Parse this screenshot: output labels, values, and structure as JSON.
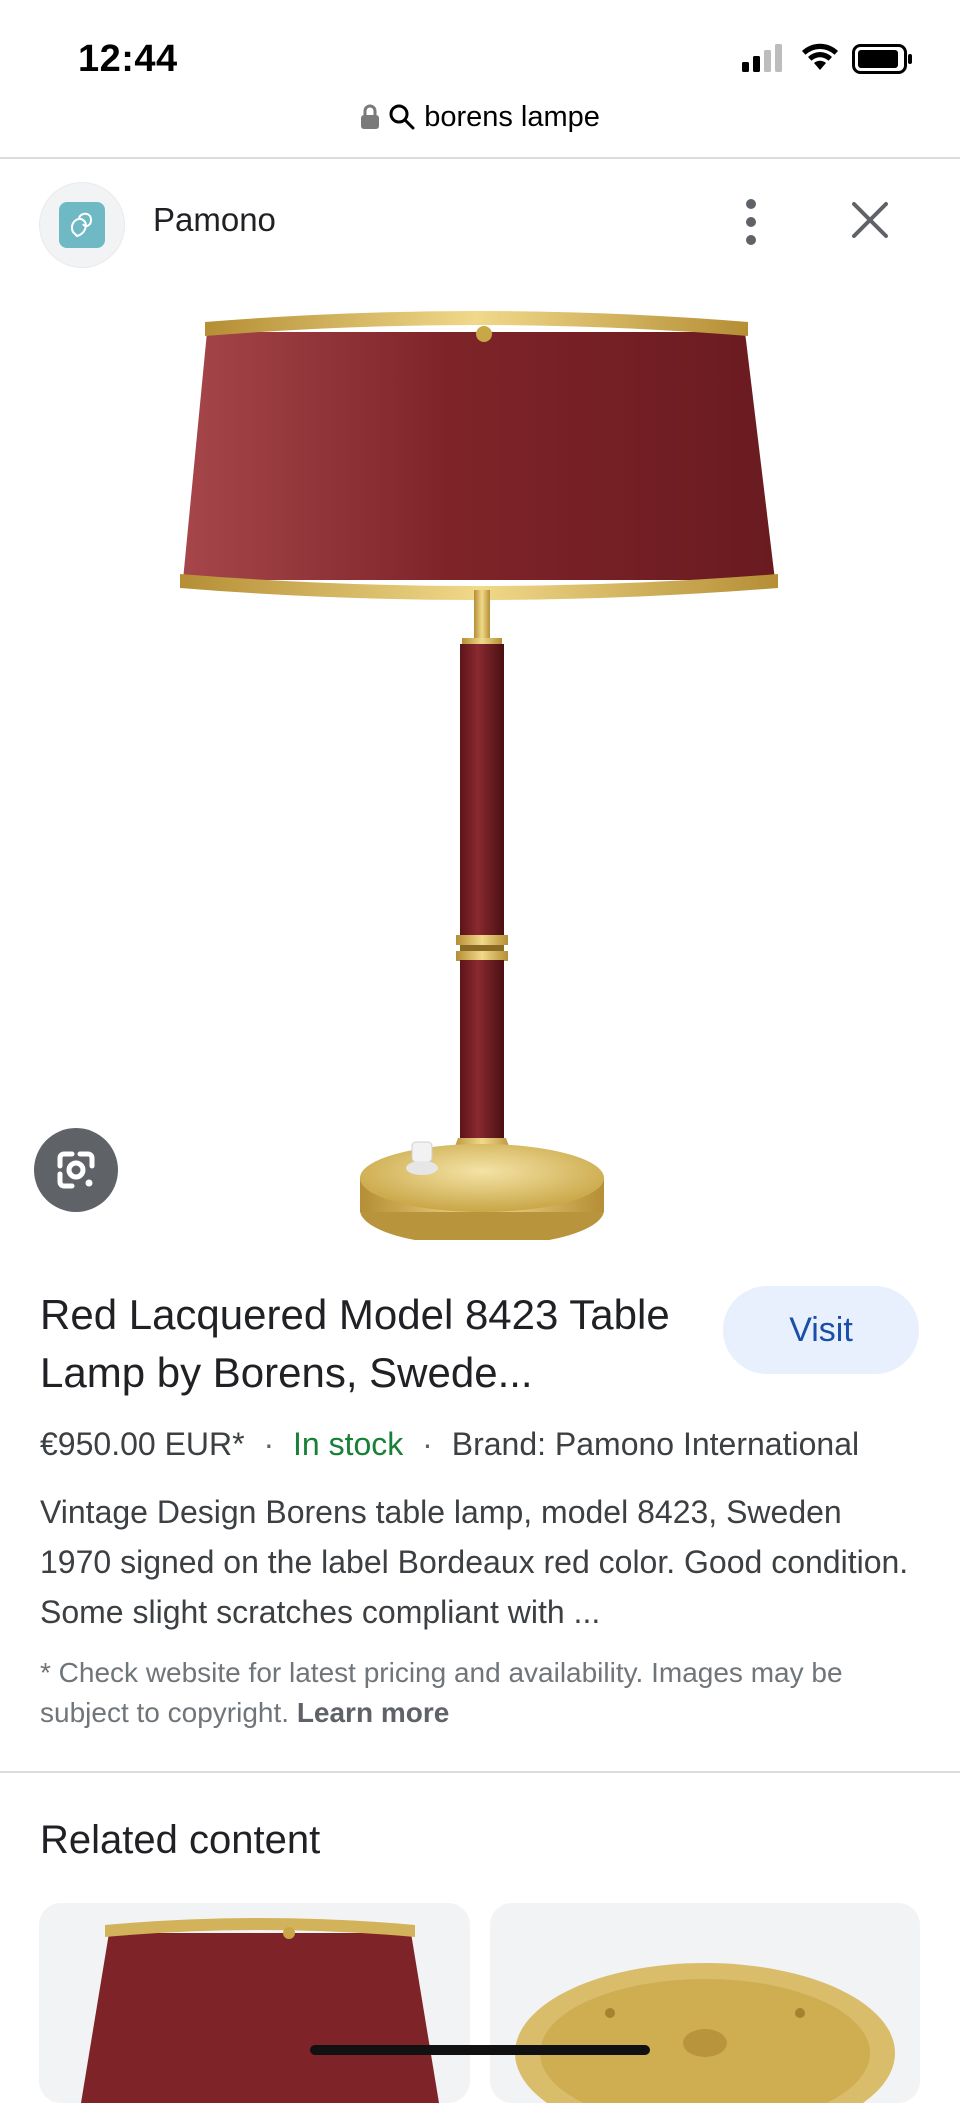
{
  "status_bar": {
    "time": "12:44"
  },
  "address_bar": {
    "query": "borens lampe"
  },
  "source": {
    "name": "Pamono",
    "avatar_color": "#6fb9c4"
  },
  "product": {
    "title": "Red Lacquered Model 8423 Table Lamp by Borens, Swede...",
    "visit_label": "Visit",
    "price": "€950.00 EUR*",
    "separator": "·",
    "stock": "In stock",
    "brand": "Brand: Pamono International",
    "description": "Vintage Design Borens table lamp, model 8423, Sweden 1970 signed on the label Bordeaux red color. Good condition. Some slight scratches compliant with ...",
    "disclaimer": "* Check website for latest pricing and availability. Images may be subject to copyright.",
    "learn_more": "Learn more"
  },
  "related": {
    "heading": "Related content"
  },
  "colors": {
    "accent_link": "#1a4ea8",
    "visit_bg": "#e8f0fe",
    "in_stock": "#188038",
    "lamp_red": "#7a1f24",
    "brass": "#c9a646"
  },
  "icons": [
    "lock-icon",
    "search-icon",
    "more-vert-icon",
    "close-icon",
    "google-lens-icon",
    "cellular-signal-icon",
    "wifi-icon",
    "battery-icon"
  ]
}
